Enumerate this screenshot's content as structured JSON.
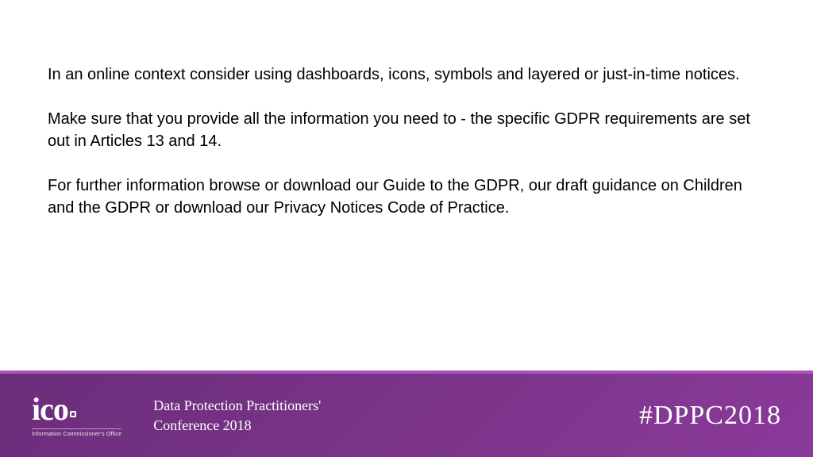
{
  "content": {
    "p1": "In an online context consider using dashboards, icons, symbols and layered or just-in-time notices.",
    "p2": "Make sure that you provide all the information you need to - the specific GDPR requirements are set out in Articles 13 and 14.",
    "p3": "For further information browse or download our Guide to the GDPR, our draft guidance on  Children and the GDPR or download our Privacy Notices Code of Practice."
  },
  "footer": {
    "logo_text": "ico",
    "logo_subtext": "Information Commissioner's Office",
    "conference_line1": "Data Protection Practitioners'",
    "conference_line2": "Conference 2018",
    "hashtag": "#DPPC2018"
  }
}
